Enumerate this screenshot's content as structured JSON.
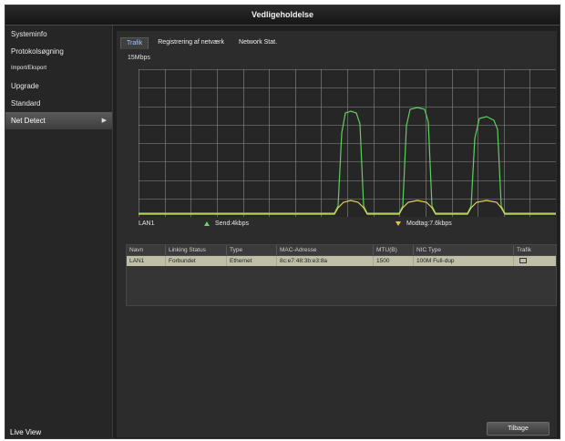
{
  "window": {
    "title": "Vedligeholdelse"
  },
  "sidebar": {
    "items": [
      {
        "label": "Systeminfo"
      },
      {
        "label": "Protokolsøgning"
      },
      {
        "label": "Import/Eksport"
      },
      {
        "label": "Upgrade"
      },
      {
        "label": "Standard"
      },
      {
        "label": "Net Detect"
      }
    ],
    "footer": "Live View"
  },
  "tabs": [
    {
      "label": "Trafik"
    },
    {
      "label": "Registrering af netværk"
    },
    {
      "label": "Network Stat."
    }
  ],
  "graph": {
    "unit": "15Mbps",
    "colors": {
      "send": "#5fcf5f",
      "receive": "#e6d25a",
      "grid": "#8c8c8c"
    }
  },
  "legend": {
    "interface": "LAN1",
    "send": "Send:4kbps",
    "receive": "Modtag:7.6kbps"
  },
  "table": {
    "headers": [
      "Navn",
      "Linking Status",
      "Type",
      "MAC-Adresse",
      "MTU(B)",
      "NIC Type",
      "Trafik"
    ],
    "rows": [
      [
        "LAN1",
        "Forbundet",
        "Ethernet",
        "8c:e7:48:3b:e3:8a",
        "1500",
        "100M Full-dup",
        ""
      ]
    ]
  },
  "buttons": {
    "back": "Tilbage"
  }
}
